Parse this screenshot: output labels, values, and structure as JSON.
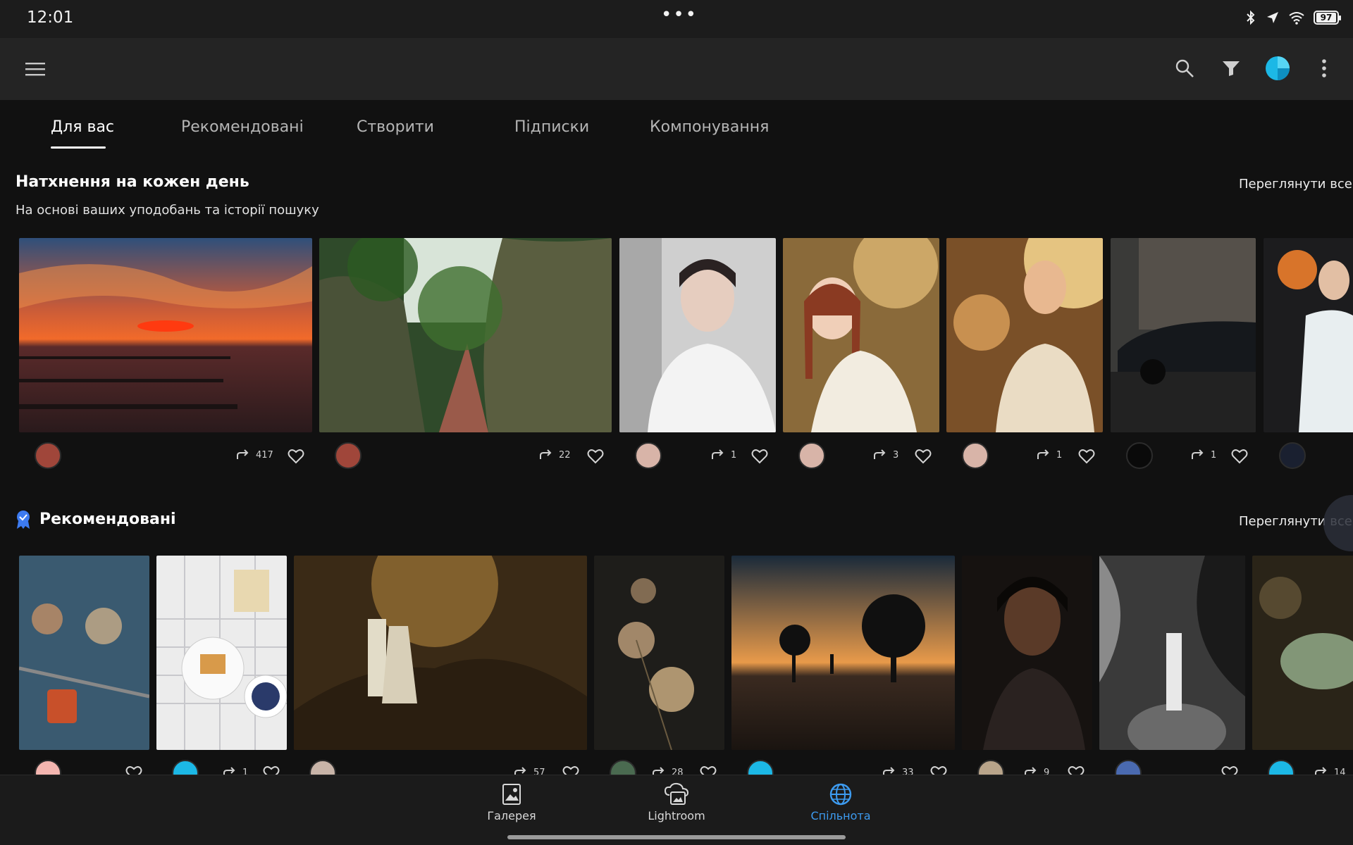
{
  "status_bar": {
    "time": "12:01",
    "dots": "•••",
    "battery": "97"
  },
  "tabs": [
    {
      "label": "Для вас",
      "active": true
    },
    {
      "label": "Рекомендовані",
      "active": false
    },
    {
      "label": "Створити",
      "active": false
    },
    {
      "label": "Підписки",
      "active": false
    },
    {
      "label": "Компонування",
      "active": false
    }
  ],
  "section_daily": {
    "title": "Натхнення на кожен день",
    "subtitle": "На основі ваших уподобань та історії пошуку",
    "see_all": "Переглянути все",
    "cards": [
      {
        "image": "sunset-sea-photo",
        "remix_count": "417"
      },
      {
        "image": "forest-path-rocks-photo",
        "remix_count": "22"
      },
      {
        "image": "woman-white-shirt-portrait",
        "remix_count": "1"
      },
      {
        "image": "woman-braids-sunlight-portrait",
        "remix_count": "3"
      },
      {
        "image": "woman-flowers-backlit-portrait",
        "remix_count": "1"
      },
      {
        "image": "black-car-street-photo",
        "remix_count": "1"
      },
      {
        "image": "basketball-player-photo",
        "remix_count": ""
      }
    ]
  },
  "section_featured": {
    "title": "Рекомендовані",
    "see_all": "Переглянути все",
    "cards": [
      {
        "image": "padlock-bokeh-photo",
        "remix_count": ""
      },
      {
        "image": "breakfast-table-photo",
        "remix_count": "1"
      },
      {
        "image": "couple-forest-photo",
        "remix_count": "57"
      },
      {
        "image": "dried-flowers-photo",
        "remix_count": "28"
      },
      {
        "image": "tree-silhouette-sunset-photo",
        "remix_count": "33"
      },
      {
        "image": "dark-portrait-photo",
        "remix_count": "9"
      },
      {
        "image": "bw-rock-climber-photo",
        "remix_count": ""
      },
      {
        "image": "green-light-abstract-photo",
        "remix_count": "14"
      }
    ]
  },
  "bottom_nav": [
    {
      "label": "Галерея",
      "icon": "gallery-icon",
      "active": false
    },
    {
      "label": "Lightroom",
      "icon": "cloud-photo-icon",
      "active": false
    },
    {
      "label": "Спільнота",
      "icon": "globe-icon",
      "active": true
    }
  ],
  "colors": {
    "accent": "#3d9bf0",
    "background": "#111111",
    "appbar": "#242424",
    "avatar_cyan": "#1cb8e6"
  }
}
